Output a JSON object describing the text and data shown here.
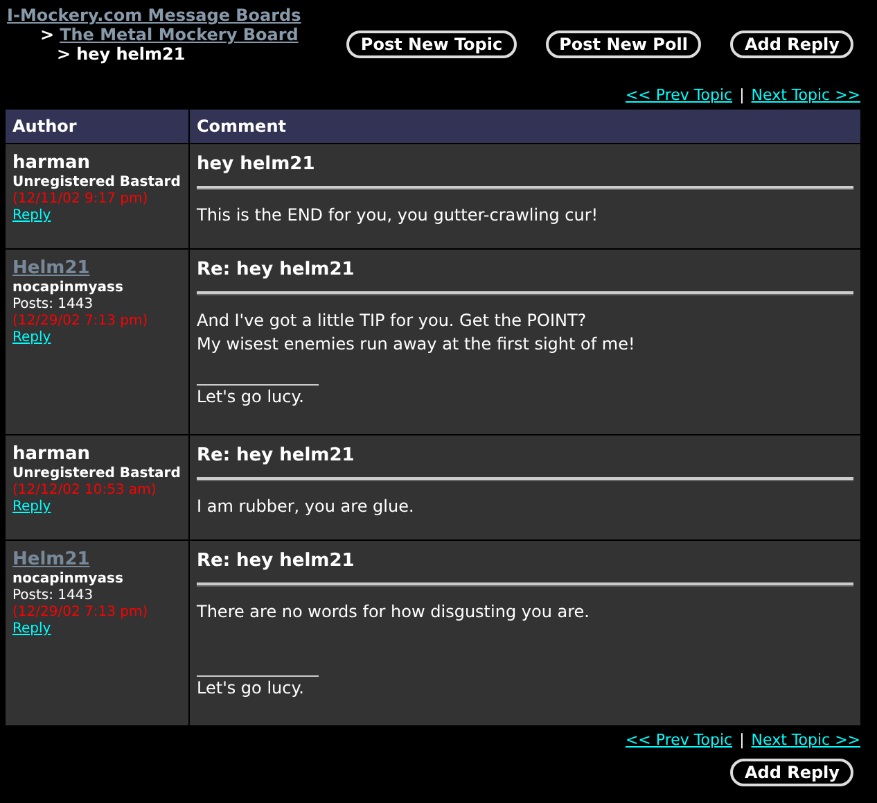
{
  "breadcrumbs": [
    {
      "label": "I-Mockery.com Message Boards",
      "link": true
    },
    {
      "label": "The Metal Mockery Board",
      "link": true
    },
    {
      "label": "hey helm21",
      "link": false
    }
  ],
  "breadcrumb_separator": ">",
  "top_buttons": [
    "Post New Topic",
    "Post New Poll",
    "Add Reply"
  ],
  "topic_nav_top": {
    "prev": "<< Prev Topic",
    "separator": "|",
    "next": "Next Topic >>"
  },
  "table": {
    "columns": [
      "Author",
      "Comment"
    ],
    "posts": [
      {
        "author": "harman",
        "registered": false,
        "rank": "Unregistered Bastard",
        "date": "(12/11/02 9:17 pm)",
        "reply": "Reply",
        "subject": "hey helm21",
        "body": [
          "This is the END for you, you gutter-crawling cur!"
        ]
      },
      {
        "author": "Helm21",
        "registered": true,
        "rank": "nocapinmyass",
        "posts": "Posts: 1443",
        "date": "(12/29/02 7:13 pm)",
        "reply": "Reply",
        "subject": "Re: hey helm21",
        "body": [
          "And I've got a little TIP for you. Get the POINT?",
          "My wisest enemies run away at the first sight of me!"
        ],
        "signature": "Let's go lucy."
      },
      {
        "author": "harman",
        "registered": false,
        "rank": "Unregistered Bastard",
        "date": "(12/12/02 10:53 am)",
        "reply": "Reply",
        "subject": "Re: hey helm21",
        "body": [
          "I am rubber, you are glue."
        ]
      },
      {
        "author": "Helm21",
        "registered": true,
        "rank": "nocapinmyass",
        "posts": "Posts: 1443",
        "date": "(12/29/02 7:13 pm)",
        "reply": "Reply",
        "subject": "Re: hey helm21",
        "body": [
          "There are no words for how disgusting you are."
        ],
        "signature": "Let's go lucy."
      }
    ]
  },
  "topic_nav_bottom": {
    "prev": "<< Prev Topic",
    "separator": "|",
    "next": "Next Topic >>"
  },
  "bottom_button": "Add Reply"
}
